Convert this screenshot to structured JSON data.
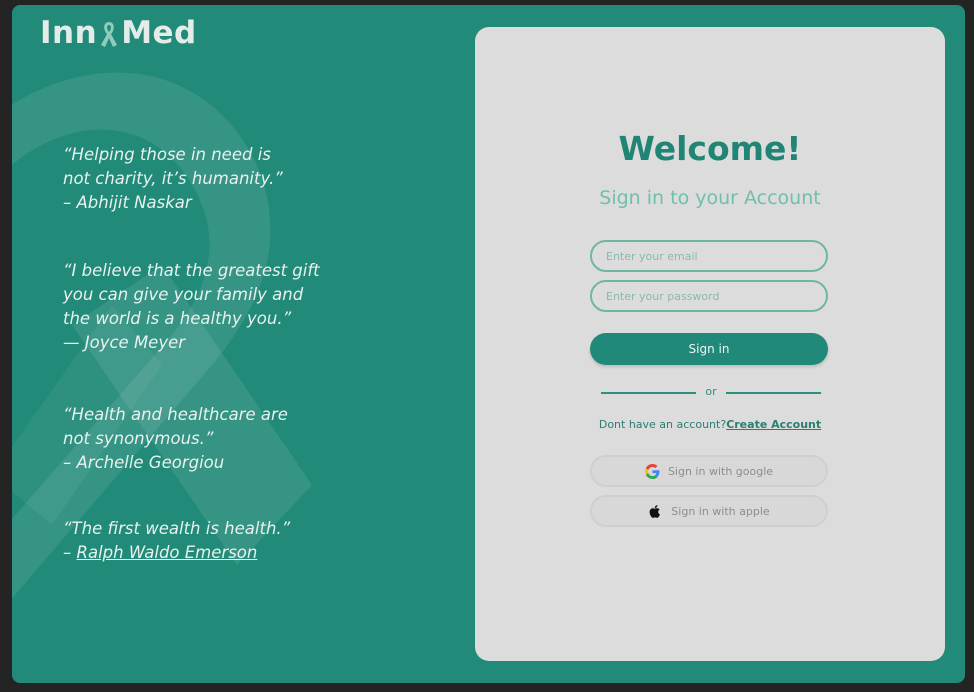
{
  "brand": {
    "logo_left": "Inn",
    "logo_right": "Med"
  },
  "quotes": [
    {
      "text": "“Helping those in need is\nnot charity, it’s humanity.”",
      "author": "– Abhijit Naskar"
    },
    {
      "text": "“I believe that the greatest gift\nyou can give your family and\nthe world is a healthy you.”",
      "author": "— Joyce Meyer"
    },
    {
      "text": "“Health and healthcare are\nnot synonymous.”",
      "author": "– Archelle Georgiou"
    },
    {
      "text": "“The first wealth is health.”",
      "author_prefix": "– ",
      "author_link": "Ralph Waldo Emerson"
    }
  ],
  "login": {
    "title": "Welcome!",
    "subtitle": "Sign in to your Account",
    "email_placeholder": "Enter your email",
    "email_value": "",
    "password_placeholder": "Enter your password",
    "password_value": "",
    "signin_label": "Sign in",
    "divider_text": "or",
    "no_account_text": "Dont have an account?",
    "create_account_label": "Create Account",
    "google_label": "Sign in with google",
    "apple_label": "Sign in with apple"
  },
  "colors": {
    "background": "#218a78",
    "card": "#dcdcdc",
    "accent": "#208574",
    "accent_light": "#6fbfae"
  },
  "icons": {
    "logo_mark": "ribbon-icon",
    "google": "google-icon",
    "apple": "apple-icon"
  }
}
